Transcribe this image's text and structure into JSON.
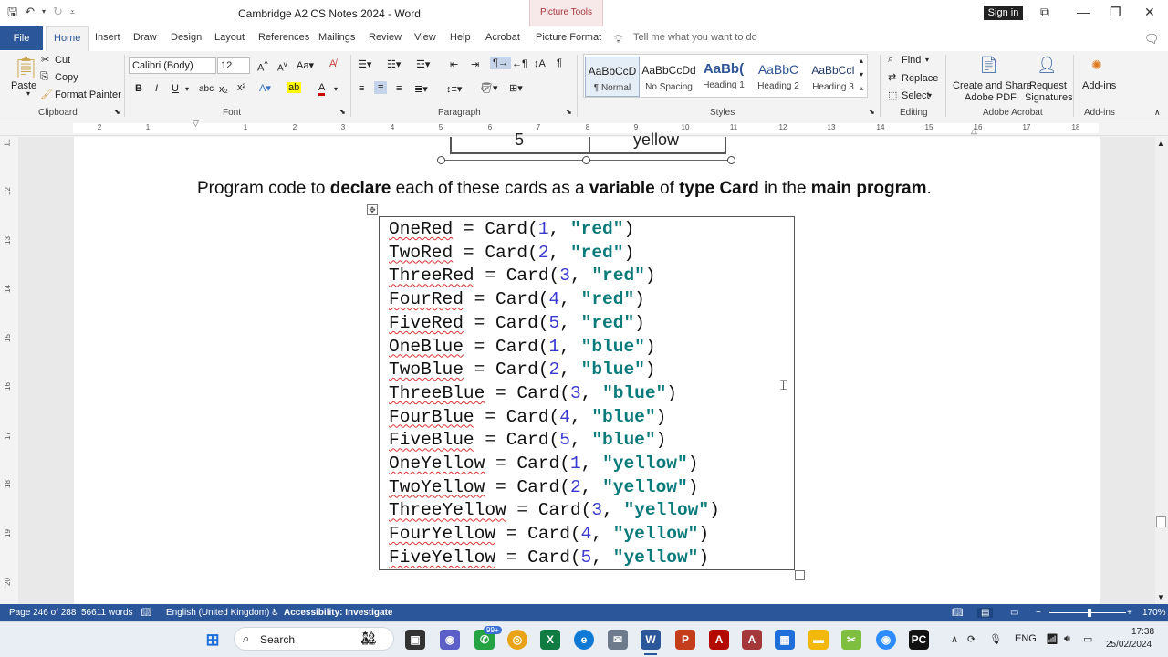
{
  "window": {
    "title": "Cambridge A2 CS Notes 2024  -  Word",
    "contextual_group": "Picture Tools",
    "sign_in": "Sign in"
  },
  "tabs": [
    "Home",
    "Insert",
    "Draw",
    "Design",
    "Layout",
    "References",
    "Mailings",
    "Review",
    "View",
    "Help",
    "Acrobat",
    "Picture Format"
  ],
  "file_tab": "File",
  "tell_me": "Tell me what you want to do",
  "ribbon": {
    "clipboard": {
      "paste": "Paste",
      "cut": "Cut",
      "copy": "Copy",
      "format_painter": "Format Painter",
      "label": "Clipboard"
    },
    "font": {
      "name": "Calibri (Body)",
      "size": "12",
      "label": "Font"
    },
    "paragraph": {
      "label": "Paragraph"
    },
    "styles": {
      "label": "Styles",
      "items": [
        {
          "preview": "AaBbCcD",
          "name": "¶ Normal"
        },
        {
          "preview": "AaBbCcDd",
          "name": "No Spacing"
        },
        {
          "preview": "AaBb(",
          "name": "Heading 1"
        },
        {
          "preview": "AaBbC",
          "name": "Heading 2"
        },
        {
          "preview": "AaBbCcI",
          "name": "Heading 3"
        }
      ]
    },
    "editing": {
      "find": "Find",
      "replace": "Replace",
      "select": "Select",
      "label": "Editing"
    },
    "acrobat": {
      "create": "Create and Share",
      "create2": "Adobe PDF",
      "request": "Request",
      "request2": "Signatures",
      "label": "Adobe Acrobat"
    },
    "addins": {
      "button": "Add-ins",
      "label": "Add-ins"
    }
  },
  "ruler": {
    "h_marks": [
      "2",
      "1",
      "1",
      "2",
      "3",
      "4",
      "5",
      "6",
      "7",
      "8",
      "9",
      "10",
      "11",
      "12",
      "13",
      "14",
      "15",
      "16",
      "17",
      "18"
    ],
    "v_marks": [
      "11",
      "12",
      "13",
      "14",
      "15",
      "16",
      "17",
      "18",
      "19",
      "20"
    ]
  },
  "document": {
    "image_cells": [
      "5",
      "yellow"
    ],
    "paragraph": {
      "p1": "Program code to ",
      "b1": "declare",
      "p2": " each of these cards as a ",
      "b2": "variable",
      "p3": " of ",
      "b3": "type Card",
      "p4": " in the ",
      "b4": "main program",
      "p5": "."
    },
    "code": [
      {
        "var": "OneRed",
        "mid": " = Card(",
        "num": "1",
        "sep": ", ",
        "str": "\"red\"",
        "end": ")"
      },
      {
        "var": "TwoRed",
        "mid": " = Card(",
        "num": "2",
        "sep": ", ",
        "str": "\"red\"",
        "end": ")"
      },
      {
        "var": "ThreeRed",
        "mid": " = Card(",
        "num": "3",
        "sep": ", ",
        "str": "\"red\"",
        "end": ")"
      },
      {
        "var": "FourRed",
        "mid": " = Card(",
        "num": "4",
        "sep": ", ",
        "str": "\"red\"",
        "end": ")"
      },
      {
        "var": "FiveRed",
        "mid": " = Card(",
        "num": "5",
        "sep": ", ",
        "str": "\"red\"",
        "end": ")"
      },
      {
        "var": "OneBlue",
        "mid": " = Card(",
        "num": "1",
        "sep": ", ",
        "str": "\"blue\"",
        "end": ")"
      },
      {
        "var": "TwoBlue",
        "mid": " = Card(",
        "num": "2",
        "sep": ", ",
        "str": "\"blue\"",
        "end": ")"
      },
      {
        "var": "ThreeBlue",
        "mid": " = Card(",
        "num": "3",
        "sep": ", ",
        "str": "\"blue\"",
        "end": ")"
      },
      {
        "var": "FourBlue",
        "mid": " = Card(",
        "num": "4",
        "sep": ", ",
        "str": "\"blue\"",
        "end": ")"
      },
      {
        "var": "FiveBlue",
        "mid": " = Card(",
        "num": "5",
        "sep": ", ",
        "str": "\"blue\"",
        "end": ")"
      },
      {
        "var": "OneYellow",
        "mid": " = Card(",
        "num": "1",
        "sep": ", ",
        "str": "\"yellow\"",
        "end": ")"
      },
      {
        "var": "TwoYellow",
        "mid": " = Card(",
        "num": "2",
        "sep": ", ",
        "str": "\"yellow\"",
        "end": ")"
      },
      {
        "var": "ThreeYellow",
        "mid": " = Card(",
        "num": "3",
        "sep": ", ",
        "str": "\"yellow\"",
        "end": ")"
      },
      {
        "var": "FourYellow",
        "mid": " = Card(",
        "num": "4",
        "sep": ", ",
        "str": "\"yellow\"",
        "end": ")"
      },
      {
        "var": "FiveYellow",
        "mid": " = Card(",
        "num": "5",
        "sep": ", ",
        "str": "\"yellow\"",
        "end": ")"
      }
    ]
  },
  "status": {
    "page": "Page 246 of 288",
    "words": "56611 words",
    "language": "English (United Kingdom)",
    "accessibility": "Accessibility: Investigate",
    "zoom": "170%"
  },
  "taskbar": {
    "search": "Search",
    "badge": "99+",
    "lang": "ENG",
    "time": "17:38",
    "date": "25/02/2024"
  },
  "colors": {
    "brand": "#2b579a",
    "string": "#0b7a7a",
    "number": "#3a3ad0",
    "spell": "#d33"
  }
}
